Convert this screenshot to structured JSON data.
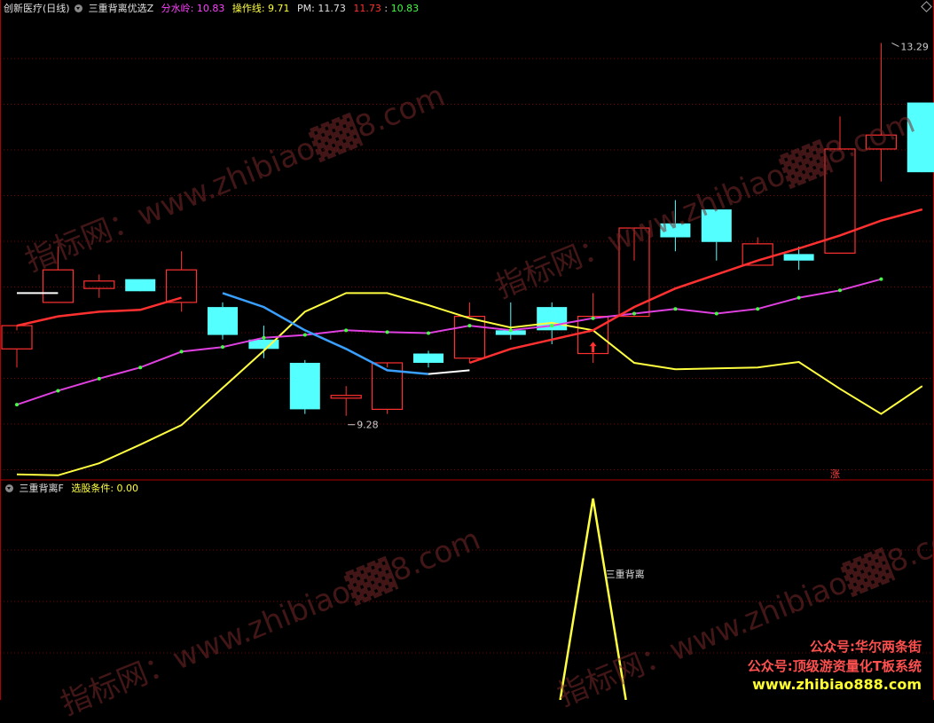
{
  "header": {
    "stock": "创新医疗(日线)",
    "indicator": "三重背离优选Z",
    "fsl_label": "分水岭: ",
    "fsl_value": "10.83",
    "czx_label": "操作线: ",
    "czx_value": "9.71",
    "pm_label": "PM: ",
    "pm_value": "11.73",
    "v1": "11.73",
    "v2": "10.83"
  },
  "sub_header": {
    "indicator": "三重背离F",
    "cond_label": "选股条件: ",
    "cond_value": "0.00"
  },
  "watermarks": [
    "指标网：www.zhibiao▓▓8.com",
    "指标网：www.zhibiao▓▓8.com",
    "指标网：www.zhibiao▓▓8.com",
    "指标网：www.zhibiao▓▓8.com"
  ],
  "promo": {
    "line1": "公众号:华尔两条街",
    "line2": "公众号:顶级游资量化T板系统",
    "line3": "www.zhibiao888.com"
  },
  "colors": {
    "up": "#ff3030",
    "down": "#54ffff",
    "fsl": "#ff3030",
    "mid": "#e040e0",
    "yellow": "#ffff40",
    "blue": "#3aa0ff",
    "white": "#ffffff",
    "grid": "#7a0000"
  },
  "chart_data": {
    "type": "candlestick",
    "ylim": [
      8.6,
      13.6
    ],
    "candles": [
      {
        "o": 10.0,
        "h": 10.2,
        "l": 9.8,
        "c": 10.25
      },
      {
        "o": 10.5,
        "h": 11.1,
        "l": 10.5,
        "c": 10.85
      },
      {
        "o": 10.65,
        "h": 10.8,
        "l": 10.55,
        "c": 10.73
      },
      {
        "o": 10.75,
        "h": 10.75,
        "l": 10.65,
        "c": 10.62
      },
      {
        "o": 10.5,
        "h": 11.05,
        "l": 10.4,
        "c": 10.85
      },
      {
        "o": 10.45,
        "h": 10.5,
        "l": 10.1,
        "c": 10.15
      },
      {
        "o": 10.1,
        "h": 10.25,
        "l": 9.9,
        "c": 10.0
      },
      {
        "o": 9.85,
        "h": 9.88,
        "l": 9.3,
        "c": 9.35
      },
      {
        "o": 9.47,
        "h": 9.6,
        "l": 9.28,
        "c": 9.5
      },
      {
        "o": 9.35,
        "h": 9.8,
        "l": 9.3,
        "c": 9.85
      },
      {
        "o": 9.95,
        "h": 9.98,
        "l": 9.8,
        "c": 9.85
      },
      {
        "o": 9.9,
        "h": 10.5,
        "l": 9.85,
        "c": 10.35
      },
      {
        "o": 10.2,
        "h": 10.5,
        "l": 10.1,
        "c": 10.15
      },
      {
        "o": 10.45,
        "h": 10.5,
        "l": 10.05,
        "c": 10.2
      },
      {
        "o": 9.95,
        "h": 10.6,
        "l": 9.85,
        "c": 10.35
      },
      {
        "o": 10.35,
        "h": 10.95,
        "l": 10.35,
        "c": 11.3
      },
      {
        "o": 11.35,
        "h": 11.6,
        "l": 11.05,
        "c": 11.2
      },
      {
        "o": 11.5,
        "h": 11.5,
        "l": 10.95,
        "c": 11.15
      },
      {
        "o": 10.9,
        "h": 11.2,
        "l": 10.9,
        "c": 11.13
      },
      {
        "o": 11.02,
        "h": 11.1,
        "l": 10.85,
        "c": 10.95
      },
      {
        "o": 11.03,
        "h": 12.5,
        "l": 11.03,
        "c": 12.15
      },
      {
        "o": 12.15,
        "h": 13.29,
        "l": 11.8,
        "c": 12.3
      },
      {
        "o": 12.65,
        "h": 12.65,
        "l": 12.0,
        "c": 11.9
      }
    ],
    "fsl_line": [
      10.25,
      10.35,
      10.4,
      10.42,
      10.55,
      null,
      null,
      null,
      null,
      null,
      null,
      9.85,
      10.0,
      10.1,
      10.2,
      10.45,
      10.65,
      10.8,
      10.95,
      11.08,
      11.22,
      11.38,
      11.5
    ],
    "mid_line": [
      9.4,
      9.55,
      9.68,
      9.8,
      9.97,
      10.02,
      10.12,
      10.15,
      10.2,
      10.18,
      10.17,
      10.25,
      10.2,
      10.25,
      10.33,
      10.38,
      10.43,
      10.38,
      10.43,
      10.55,
      10.63,
      10.75
    ],
    "yellow_line": [
      8.65,
      8.64,
      8.77,
      8.97,
      9.18,
      9.58,
      9.98,
      10.4,
      10.6,
      10.6,
      10.47,
      10.33,
      10.23,
      10.28,
      10.2,
      9.85,
      9.78,
      9.79,
      9.8,
      9.86,
      9.57,
      9.3,
      9.6
    ],
    "blue_line": [
      null,
      null,
      null,
      null,
      null,
      10.6,
      10.45,
      10.2,
      10.0,
      9.77,
      9.73
    ],
    "white_line": [
      10.6,
      10.6,
      null,
      null,
      null,
      null,
      null,
      null,
      null,
      null,
      9.73,
      9.77
    ],
    "labels": {
      "low": "9.28",
      "high": "13.29",
      "rise": "涨",
      "signal": "三重背离"
    },
    "signal": {
      "index": 14,
      "value": 1
    }
  }
}
